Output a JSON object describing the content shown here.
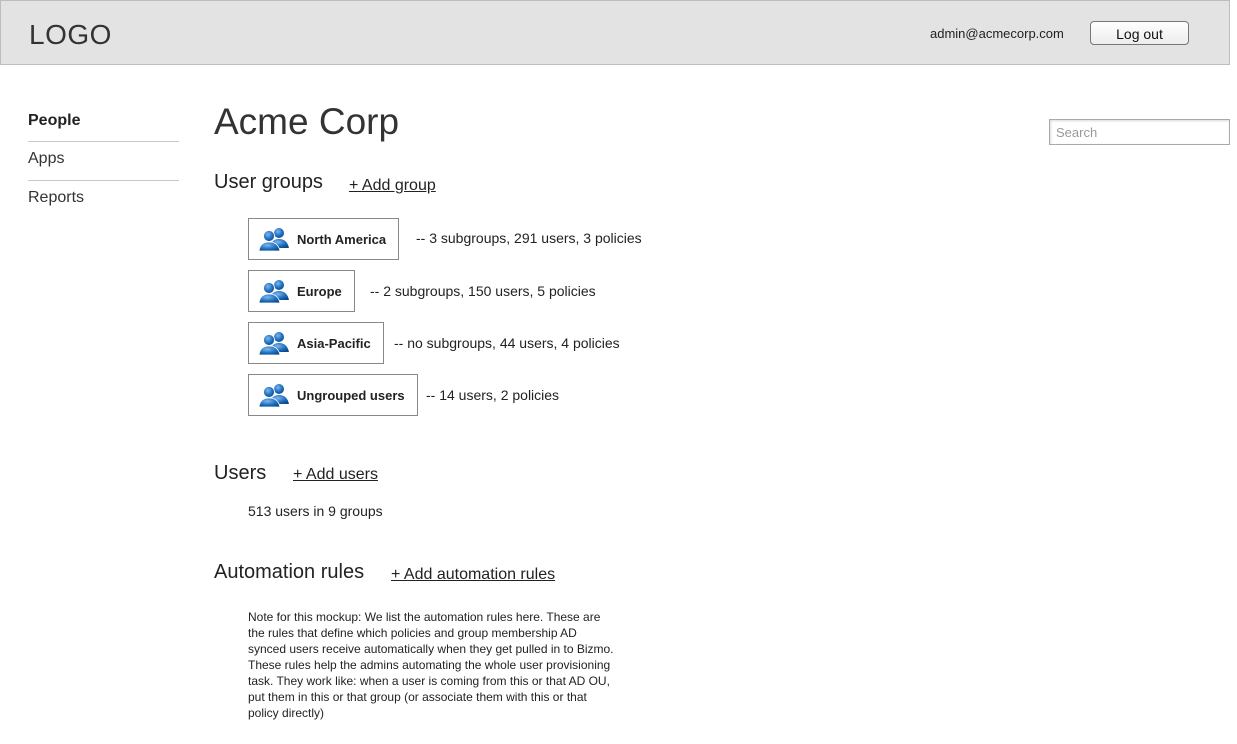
{
  "header": {
    "logo": "LOGO",
    "user_email": "admin@acmecorp.com",
    "logout_label": "Log out"
  },
  "sidebar": {
    "items": [
      {
        "label": "People",
        "active": true
      },
      {
        "label": "Apps",
        "active": false
      },
      {
        "label": "Reports",
        "active": false
      }
    ]
  },
  "search": {
    "placeholder": "Search",
    "value": ""
  },
  "main": {
    "title": "Acme Corp",
    "user_groups": {
      "heading": "User groups",
      "add_label": "+ Add group",
      "groups": [
        {
          "name": "North America",
          "info": "-- 3 subgroups, 291 users, 3 policies",
          "icon": "users-group-icon"
        },
        {
          "name": "Europe",
          "info": "-- 2 subgroups, 150 users, 5 policies",
          "icon": "users-group-icon"
        },
        {
          "name": "Asia-Pacific",
          "info": "-- no subgroups, 44 users, 4 policies",
          "icon": "users-group-icon"
        },
        {
          "name": "Ungrouped users",
          "info": "-- 14 users, 2 policies",
          "icon": "users-group-icon"
        }
      ]
    },
    "users": {
      "heading": "Users",
      "add_label": "+ Add users",
      "summary": "513 users in 9 groups"
    },
    "automation": {
      "heading": "Automation rules",
      "add_label": "+ Add automation rules",
      "note_1": "Note for this mockup: We list the automation rules here. These are the rules that define which policies and group membership AD synced users receive automatically when they get pulled in to Bizmo.",
      "note_2": "These rules help the admins automating the whole user provisioning task. They work like: when a user is coming from this or that AD OU, put them in this or that group (or associate them with this or that policy directly)"
    }
  },
  "colors": {
    "header_bg": "#e3e3e3",
    "icon_blue": "#1f6fbf"
  }
}
